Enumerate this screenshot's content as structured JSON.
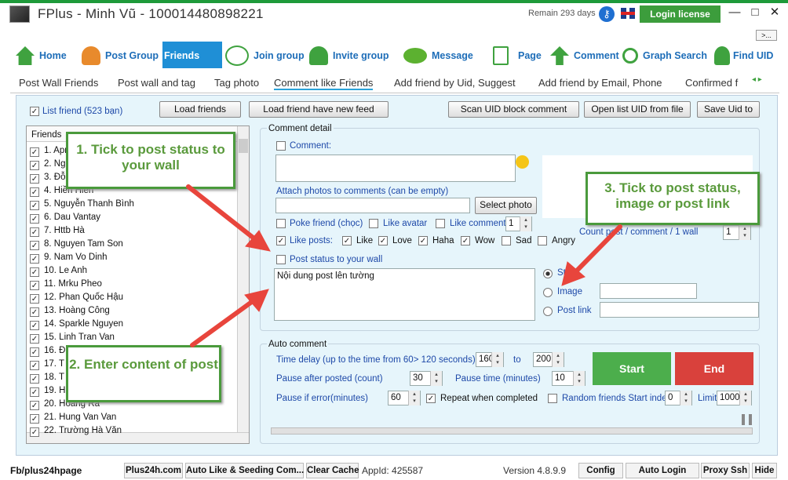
{
  "window": {
    "title": "FPlus - Minh Vũ - 100014480898221",
    "remain": "Remain 293 days",
    "login_license": "Login license",
    "minimize": "—",
    "maximize": "□",
    "close": "✕",
    "more": ">..."
  },
  "nav": [
    {
      "label": "Home"
    },
    {
      "label": "Post Group"
    },
    {
      "label": "Friends"
    },
    {
      "label": "Join group"
    },
    {
      "label": "Invite group"
    },
    {
      "label": "Message"
    },
    {
      "label": "Page"
    },
    {
      "label": "Comment"
    },
    {
      "label": "Graph Search"
    },
    {
      "label": "Find UID"
    }
  ],
  "tabs": [
    "Post Wall Friends",
    "Post wall and tag",
    "Tag photo",
    "Comment like Friends",
    "Add friend by Uid, Suggest",
    "Add friend by Email, Phone",
    "Confirmed f"
  ],
  "toolbar": {
    "list_friend": "List friend (523 bạn)",
    "load_friends": "Load friends",
    "load_friend_feed": "Load friend have new feed",
    "scan_uid": "Scan UID block comment",
    "open_list": "Open list UID from file",
    "save_uid": "Save Uid to"
  },
  "friends": {
    "header": "Friends",
    "items": [
      "1. Apr",
      "2. Ng",
      "3. Đỗ",
      "4. Hiền Hiền",
      "5. Nguyễn Thanh Bình",
      "6. Dau Vantay",
      "7. Httb Hà",
      "8. Nguyen Tam Son",
      "9. Nam Vo Dinh",
      "10. Le Anh",
      "11. Mrku Pheo",
      "12. Phan Quốc Hậu",
      "13. Hoàng Công",
      "14. Sparkle Nguyen",
      "15. Linh Tran Van",
      "16. Đ",
      "17. T",
      "18. T",
      "19. H",
      "20. Hoàng Ra",
      "21. Hung Van Van",
      "22. Trường Hà Văn"
    ]
  },
  "comment_detail": {
    "title": "Comment detail",
    "comment": "Comment:",
    "attach": "Attach photos to comments (can be empty)",
    "select_photo": "Select photo",
    "poke": "Poke friend (chọc)",
    "like_avatar": "Like avatar",
    "like_comment": "Like comment",
    "like_comment_count": "1",
    "like_posts": "Like posts:",
    "reactions": [
      "Like",
      "Love",
      "Haha",
      "Wow",
      "Sad",
      "Angry"
    ],
    "count_post": "Count post / comment / 1 wall",
    "count_value": "1",
    "post_status": "Post status to your wall",
    "post_content": "Nội dung post lên tường",
    "status_opt": "Sta",
    "image_opt": "Image",
    "postlink_opt": "Post link"
  },
  "auto_comment": {
    "title": "Auto comment",
    "time_delay": "Time delay (up to the time from 60> 120 seconds)",
    "delay_from": "160",
    "to": "to",
    "delay_to": "200",
    "pause_after": "Pause after posted (count)",
    "pause_after_val": "30",
    "pause_time": "Pause time (minutes)",
    "pause_time_val": "10",
    "pause_error": "Pause if error(minutes)",
    "pause_error_val": "60",
    "repeat": "Repeat when completed",
    "random": "Random friends Start index:",
    "start_index": "0",
    "limit": "Limit",
    "limit_val": "1000",
    "start": "Start",
    "end": "End"
  },
  "callouts": {
    "c1": "1. Tick to post status to your wall",
    "c2": "2. Enter content of post",
    "c3": "3. Tick to post status, image or post link"
  },
  "status": {
    "fb": "Fb/plus24hpage",
    "plus24h": "Plus24h.com",
    "auto_like": "Auto Like & Seeding Com...",
    "clear_cache": "Clear Cache",
    "appid": "AppId: 425587",
    "version": "Version 4.8.9.9",
    "config": "Config",
    "auto_login": "Auto Login",
    "proxy": "Proxy Ssh",
    "hide": "Hide"
  },
  "colors": {
    "accent_green": "#3c9d3c",
    "start": "#4cae4c",
    "end": "#d9413c",
    "nav_blue": "#1d6db8",
    "callout_border": "#4a9a3c",
    "arrow": "#e8453c"
  }
}
